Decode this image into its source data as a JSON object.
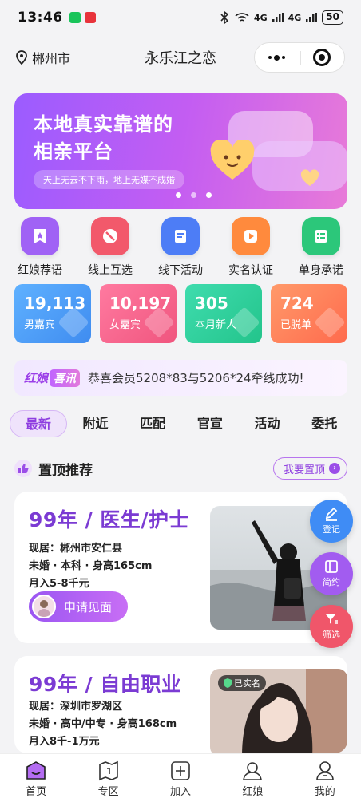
{
  "status_bar": {
    "time": "13:46",
    "battery": "50",
    "signal1": "4G",
    "signal2": "4G"
  },
  "nav": {
    "location": "郴州市",
    "title": "永乐江之恋"
  },
  "banner": {
    "headline_1": "本地真实靠谱的",
    "headline_2": "相亲平台",
    "subtitle": "天上无云不下雨，地上无媒不成婚"
  },
  "quick_menu": [
    {
      "label": "红娘荐语",
      "color": "#a062f5",
      "icon": "star-bookmark-icon"
    },
    {
      "label": "线上互选",
      "color": "#f2596b",
      "icon": "no-entry-icon"
    },
    {
      "label": "线下活动",
      "color": "#4d7df6",
      "icon": "book-icon"
    },
    {
      "label": "实名认证",
      "color": "#ff8a3d",
      "icon": "play-icon"
    },
    {
      "label": "单身承诺",
      "color": "#2cc77a",
      "icon": "list-icon"
    }
  ],
  "stats": [
    {
      "value": "19,113",
      "label": "男嘉宾",
      "color": "#4ea0f6"
    },
    {
      "value": "10,197",
      "label": "女嘉宾",
      "color": "#f5608c"
    },
    {
      "value": "305",
      "label": "本月新人",
      "color": "#2fcc9a"
    },
    {
      "value": "724",
      "label": "已脱单",
      "color": "#ff7e5a"
    }
  ],
  "notice": {
    "tag1": "红娘",
    "tag2": "喜讯",
    "text": "恭喜会员5208*83与5206*24牵线成功!"
  },
  "tabs": [
    "最新",
    "附近",
    "匹配",
    "官宣",
    "活动",
    "委托"
  ],
  "section": {
    "title": "置顶推荐",
    "action": "我要置顶"
  },
  "cards": [
    {
      "headline": "99年 / 医生/护士",
      "residence": "现居：郴州市安仁县",
      "details": "未婚 · 本科 · 身高165cm",
      "income": "月入5-8千元",
      "action": "申请见面"
    },
    {
      "headline": "99年 / 自由职业",
      "residence": "现居：深圳市罗湖区",
      "details": "未婚 · 高中/中专 · 身高168cm",
      "income": "月入8千-1万元",
      "badge": "已实名"
    }
  ],
  "fabs": [
    {
      "label": "登记",
      "color": "#3f8cf5",
      "icon": "edit-icon"
    },
    {
      "label": "简约",
      "color": "#a25cf0",
      "icon": "layout-icon"
    },
    {
      "label": "筛选",
      "color": "#f0566a",
      "icon": "filter-icon"
    }
  ],
  "tabbar": [
    {
      "label": "首页",
      "icon": "home-icon"
    },
    {
      "label": "专区",
      "icon": "map-icon"
    },
    {
      "label": "加入",
      "icon": "add-icon"
    },
    {
      "label": "红娘",
      "icon": "matchmaker-icon"
    },
    {
      "label": "我的",
      "icon": "profile-icon"
    }
  ]
}
